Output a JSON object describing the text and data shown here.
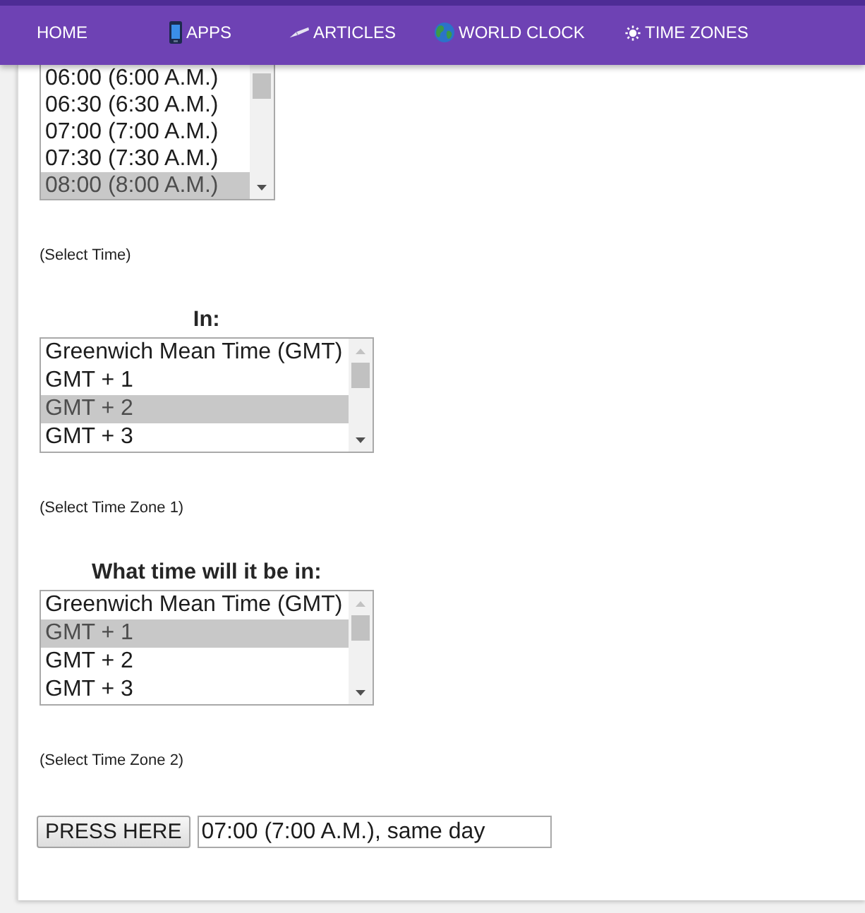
{
  "nav": {
    "items": [
      {
        "label": "HOME"
      },
      {
        "label": "APPS"
      },
      {
        "label": "ARTICLES"
      },
      {
        "label": "WORLD CLOCK"
      },
      {
        "label": "TIME ZONES"
      }
    ]
  },
  "pickers": [
    {
      "options": [
        {
          "label": "06:00 (6:00 A.M.)",
          "selected": false
        },
        {
          "label": "06:30 (6:30 A.M.)",
          "selected": false
        },
        {
          "label": "07:00 (7:00 A.M.)",
          "selected": false
        },
        {
          "label": "07:30 (7:30 A.M.)",
          "selected": false
        },
        {
          "label": "08:00 (8:00 A.M.)",
          "selected": true
        }
      ],
      "hint": "(Select Time)"
    },
    {
      "heading": "In:",
      "options": [
        {
          "label": "Greenwich Mean Time (GMT)",
          "selected": false
        },
        {
          "label": "GMT + 1",
          "selected": false
        },
        {
          "label": "GMT + 2",
          "selected": true
        },
        {
          "label": "GMT + 3",
          "selected": false
        }
      ],
      "hint": "(Select Time Zone 1)"
    },
    {
      "heading": "What time will it be in:",
      "options": [
        {
          "label": "Greenwich Mean Time (GMT)",
          "selected": false
        },
        {
          "label": "GMT + 1",
          "selected": true
        },
        {
          "label": "GMT + 2",
          "selected": false
        },
        {
          "label": "GMT + 3",
          "selected": false
        }
      ],
      "hint": "(Select Time Zone 2)"
    }
  ],
  "result": {
    "button": "PRESS HERE",
    "value": "07:00 (7:00 A.M.), same day"
  }
}
